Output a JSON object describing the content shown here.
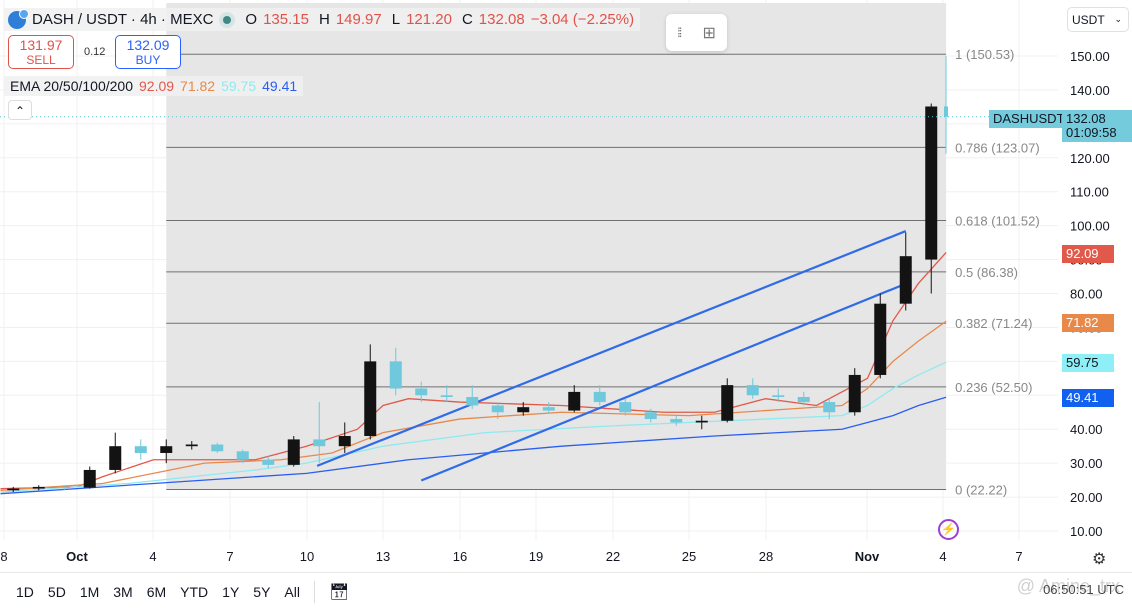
{
  "header": {
    "symbol": "DASH / USDT · 4h · MEXC",
    "ohlc": {
      "o_label": "O",
      "o": "135.15",
      "h_label": "H",
      "h": "149.97",
      "l_label": "L",
      "l": "121.20",
      "c_label": "C",
      "c": "132.08",
      "change": "−3.04 (−2.25%)"
    }
  },
  "trade": {
    "sell_price": "131.97",
    "sell_label": "SELL",
    "spread": "0.12",
    "buy_price": "132.09",
    "buy_label": "BUY"
  },
  "ema": {
    "label": "EMA 20/50/100/200",
    "v20": "92.09",
    "v50": "71.82",
    "v100": "59.75",
    "v200": "49.41"
  },
  "currency": "USDT",
  "price_tag": {
    "symbol": "DASHUSDT",
    "price": "132.08",
    "countdown": "01:09:58"
  },
  "colors": {
    "up": "#131313",
    "down": "#6fc8dc",
    "ema20": "#e0594a",
    "ema50": "#e8894a",
    "ema100": "#8eeaf0",
    "ema200": "#2a5ef0",
    "trend": "#2f6be8",
    "fib": "#707070",
    "shade": "#e6e6e6"
  },
  "bottom": {
    "ranges": [
      "1D",
      "5D",
      "1M",
      "3M",
      "6M",
      "YTD",
      "1Y",
      "5Y",
      "All"
    ],
    "clock": "06:50:51 UTC",
    "watermark": "@ Amine_trx"
  },
  "chart_data": {
    "type": "candlestick",
    "ylim": [
      10,
      150
    ],
    "yticks": [
      "150.00",
      "140.00",
      "130.00",
      "120.00",
      "110.00",
      "100.00",
      "90.00",
      "80.00",
      "70.00",
      "60.00",
      "50.00",
      "40.00",
      "30.00",
      "20.00",
      "10.00"
    ],
    "xticks": [
      "8",
      "Oct",
      "4",
      "7",
      "10",
      "13",
      "16",
      "19",
      "22",
      "25",
      "28",
      "Nov",
      "4",
      "7"
    ],
    "candles": [
      [
        "Sep 28",
        22,
        23,
        21.5,
        22.5
      ],
      [
        "Sep 29",
        22.5,
        23.5,
        22,
        23
      ],
      [
        "Sep 30",
        23,
        23.5,
        22,
        22.8
      ],
      [
        "Oct 1",
        22.8,
        29,
        22.5,
        28
      ],
      [
        "Oct 2",
        28,
        39,
        27,
        35
      ],
      [
        "Oct 3",
        35,
        37,
        31,
        33
      ],
      [
        "Oct 4",
        33,
        37,
        30,
        35
      ],
      [
        "Oct 5",
        35,
        36.5,
        34,
        35.5
      ],
      [
        "Oct 6",
        35.5,
        36,
        33,
        33.5
      ],
      [
        "Oct 7",
        33.5,
        34,
        30,
        31
      ],
      [
        "Oct 8",
        31,
        32,
        28.5,
        29.5
      ],
      [
        "Oct 9",
        29.5,
        38,
        29,
        37
      ],
      [
        "Oct 10",
        37,
        48,
        30,
        35
      ],
      [
        "Oct 11",
        35,
        42,
        33,
        38
      ],
      [
        "Oct 12",
        38,
        65,
        37,
        60
      ],
      [
        "Oct 13",
        60,
        64,
        50,
        52
      ],
      [
        "Oct 14",
        52,
        54,
        48,
        50
      ],
      [
        "Oct 15",
        50,
        53,
        48,
        49.5
      ],
      [
        "Oct 16",
        49.5,
        53,
        46,
        47
      ],
      [
        "Oct 17",
        47,
        48,
        43,
        45
      ],
      [
        "Oct 18",
        45,
        48,
        44,
        46.5
      ],
      [
        "Oct 19",
        46.5,
        48,
        44.5,
        45.5
      ],
      [
        "Oct 20",
        45.5,
        53,
        45,
        51
      ],
      [
        "Oct 21",
        51,
        53,
        47,
        48
      ],
      [
        "Oct 22",
        48,
        49,
        44,
        45
      ],
      [
        "Oct 23",
        45,
        46,
        42,
        43
      ],
      [
        "Oct 24",
        43,
        44,
        41,
        42
      ],
      [
        "Oct 25",
        42,
        44,
        40,
        42.5
      ],
      [
        "Oct 26",
        42.5,
        55,
        42,
        53
      ],
      [
        "Oct 27",
        53,
        55,
        49,
        50
      ],
      [
        "Oct 28",
        50,
        52,
        48,
        49.5
      ],
      [
        "Oct 29",
        49.5,
        51,
        47,
        48
      ],
      [
        "Oct 30",
        48,
        49,
        43,
        45
      ],
      [
        "Oct 31",
        45,
        58,
        44,
        56
      ],
      [
        "Nov 1",
        56,
        80,
        55,
        77
      ],
      [
        "Nov 2",
        77,
        98,
        75,
        91
      ],
      [
        "Nov 3",
        90,
        136,
        80,
        135.12
      ],
      [
        "Nov 4 00:00",
        135.15,
        149.97,
        121.2,
        132.08
      ]
    ],
    "ema_series": [
      {
        "name": "EMA 20",
        "points": [
          [
            "Sep 28",
            22.5
          ],
          [
            "Oct 1",
            23
          ],
          [
            "Oct 2",
            26
          ],
          [
            "Oct 4",
            31
          ],
          [
            "Oct 8",
            31
          ],
          [
            "Oct 10",
            35
          ],
          [
            "Oct 12",
            40
          ],
          [
            "Oct 13",
            47
          ],
          [
            "Oct 14",
            49
          ],
          [
            "Oct 16",
            48
          ],
          [
            "Oct 20",
            47
          ],
          [
            "Oct 24",
            45
          ],
          [
            "Oct 26",
            45
          ],
          [
            "Oct 28",
            49
          ],
          [
            "Oct 30",
            47
          ],
          [
            "Nov 1",
            55
          ],
          [
            "Nov 2",
            72
          ],
          [
            "Nov 3",
            83
          ],
          [
            "Nov 4 02:00",
            92.09
          ]
        ]
      },
      {
        "name": "EMA 50",
        "points": [
          [
            "Sep 28",
            22
          ],
          [
            "Oct 2",
            24
          ],
          [
            "Oct 6",
            30
          ],
          [
            "Oct 9",
            31
          ],
          [
            "Oct 11",
            33
          ],
          [
            "Oct 13",
            39
          ],
          [
            "Oct 16",
            43
          ],
          [
            "Oct 20",
            45
          ],
          [
            "Oct 25",
            44
          ],
          [
            "Oct 29",
            46
          ],
          [
            "Oct 31",
            47
          ],
          [
            "Nov 1",
            52
          ],
          [
            "Nov 2",
            60
          ],
          [
            "Nov 3",
            66
          ],
          [
            "Nov 4 02:00",
            71.82
          ]
        ]
      },
      {
        "name": "EMA 100",
        "points": [
          [
            "Sep 28",
            21.5
          ],
          [
            "Oct 3",
            24
          ],
          [
            "Oct 8",
            28
          ],
          [
            "Oct 10",
            30
          ],
          [
            "Oct 13",
            35
          ],
          [
            "Oct 17",
            39
          ],
          [
            "Oct 22",
            41
          ],
          [
            "Oct 28",
            43
          ],
          [
            "Oct 31",
            44
          ],
          [
            "Nov 1",
            47
          ],
          [
            "Nov 2",
            52
          ],
          [
            "Nov 3",
            56
          ],
          [
            "Nov 4 02:00",
            59.75
          ]
        ]
      },
      {
        "name": "EMA 200",
        "points": [
          [
            "Sep 28",
            21
          ],
          [
            "Oct 4",
            24
          ],
          [
            "Oct 10",
            27
          ],
          [
            "Oct 14",
            31
          ],
          [
            "Oct 20",
            35
          ],
          [
            "Oct 26",
            38
          ],
          [
            "Oct 31",
            40
          ],
          [
            "Nov 1",
            42
          ],
          [
            "Nov 2",
            44
          ],
          [
            "Nov 3",
            47
          ],
          [
            "Nov 4 02:00",
            49.41
          ]
        ]
      }
    ],
    "trendlines": [
      [
        [
          "Oct 10 10:00",
          29.2
        ],
        [
          "Nov 2 12:00",
          98.4
        ]
      ],
      [
        [
          "Oct 14 12:00",
          24.9
        ],
        [
          "Nov 2 16:00",
          83.4
        ]
      ]
    ],
    "fibonacci": {
      "from": "Oct 4 12:00",
      "to": "Nov 4 02:00",
      "levels": [
        {
          "label": "1 (150.53)",
          "price": 150.53
        },
        {
          "label": "0.786 (123.07)",
          "price": 123.07
        },
        {
          "label": "0.618 (101.52)",
          "price": 101.52
        },
        {
          "label": "0.5 (86.38)",
          "price": 86.38
        },
        {
          "label": "0.382 (71.24)",
          "price": 71.24
        },
        {
          "label": "0.236 (52.50)",
          "price": 52.5
        },
        {
          "label": "0 (22.22)",
          "price": 22.22
        }
      ]
    }
  }
}
